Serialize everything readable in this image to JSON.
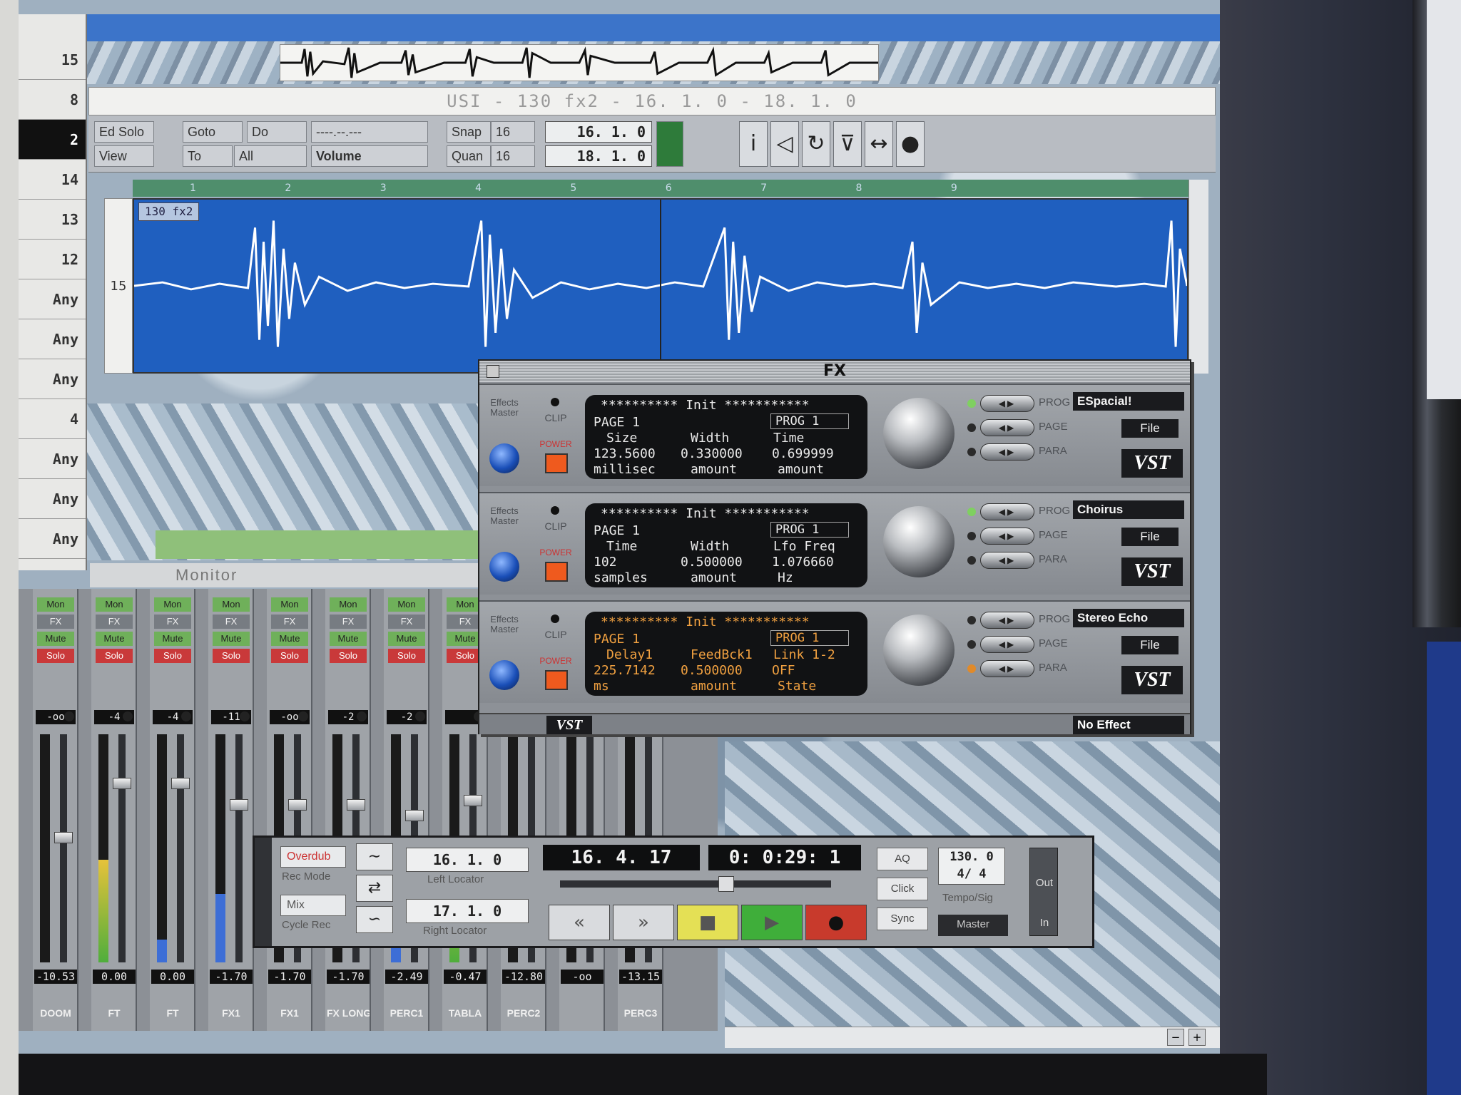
{
  "colors": {
    "accent_blue": "#1f5fbf",
    "mon_green": "#6fb05a",
    "solo_red": "#c9393a",
    "power_orange": "#ef5a1e"
  },
  "tracks": {
    "numbers": [
      "15",
      "8",
      "2",
      "14",
      "13",
      "12",
      "Any",
      "Any",
      "Any",
      "4",
      "Any",
      "Any",
      "Any"
    ]
  },
  "editor": {
    "title": "USI - 130 fx2 -  16. 1.  0 - 18. 1.  0",
    "buttons": {
      "ed_solo": "Ed Solo",
      "view": "View",
      "goto": "Goto",
      "do": "Do",
      "to": "To",
      "all": "All",
      "volume": "Volume",
      "snap": "Snap",
      "snap_val": "16",
      "quan": "Quan",
      "quan_val": "16",
      "blank_field": "----.--.---"
    },
    "loc_start": "16.  1.   0",
    "loc_end": "18.  1.   0",
    "tool_icons": [
      "info-icon",
      "speaker-icon",
      "loop-tool-icon",
      "glue-icon",
      "resize-icon",
      "color-palette-icon"
    ],
    "wave_tag": "130 fx2",
    "wave_track": "15"
  },
  "monitor_label": "Monitor",
  "mixer": {
    "labels": {
      "mon": "Mon",
      "fx": "FX",
      "mute": "Mute",
      "solo": "Solo"
    },
    "strips": [
      {
        "name": "DOOM",
        "val": "-oo",
        "db": "-10.53",
        "level": 0.0,
        "fader": 0.55
      },
      {
        "name": "FT",
        "val": "-4",
        "db": "0.00",
        "level": 0.45,
        "fader": 0.8
      },
      {
        "name": "FT",
        "val": "-4",
        "db": "0.00",
        "level": 0.1,
        "fader": 0.8
      },
      {
        "name": "FX1",
        "val": "-11",
        "db": "-1.70",
        "level": 0.3,
        "fader": 0.7
      },
      {
        "name": "FX1",
        "val": "-oo",
        "db": "-1.70",
        "level": 0.0,
        "fader": 0.7
      },
      {
        "name": "FX LONG",
        "val": "-2",
        "db": "-1.70",
        "level": 0.0,
        "fader": 0.7
      },
      {
        "name": "PERC1",
        "val": "-2",
        "db": "-2.49",
        "level": 0.35,
        "fader": 0.65
      },
      {
        "name": "TABLA",
        "val": "",
        "db": "-0.47",
        "level": 0.55,
        "fader": 0.72
      },
      {
        "name": "PERC2",
        "val": "",
        "db": "-12.80",
        "level": 0.0,
        "fader": 0.0
      },
      {
        "name": "",
        "val": "",
        "db": "-oo",
        "level": 0.0,
        "fader": 0.0
      },
      {
        "name": "PERC3",
        "val": "",
        "db": "-13.15",
        "level": 0.0,
        "fader": 0.0
      }
    ]
  },
  "fx": {
    "title": "FX",
    "side": {
      "effects_master": "Effects Master",
      "clip": "CLIP",
      "power": "POWER"
    },
    "selector_labels": {
      "prog": "PROG",
      "page": "PAGE",
      "para": "PARA"
    },
    "file_label": "File",
    "vst_label": "VST",
    "no_effect": "No Effect",
    "units": [
      {
        "name": "ESpacial!",
        "header": "********** Init ***********",
        "page": "PAGE  1",
        "prog": "PROG  1",
        "params": [
          "Size",
          "Width",
          "Time"
        ],
        "values": [
          "123.5600",
          "0.330000",
          "0.699999"
        ],
        "units": [
          "millisec",
          "amount",
          "amount"
        ]
      },
      {
        "name": "Choirus",
        "header": "********** Init ***********",
        "page": "PAGE  1",
        "prog": "PROG  1",
        "params": [
          "Time",
          "Width",
          "Lfo Freq"
        ],
        "values": [
          "102",
          "0.500000",
          "1.076660"
        ],
        "units": [
          "samples",
          "amount",
          "Hz"
        ]
      },
      {
        "name": "Stereo Echo",
        "header": "********** Init ***********",
        "page": "PAGE  1",
        "prog": "PROG  1",
        "params": [
          "Delay1",
          "FeedBck1",
          "Link 1-2"
        ],
        "values": [
          "225.7142",
          "0.500000",
          "OFF"
        ],
        "units": [
          "ms",
          "amount",
          "State"
        ]
      }
    ]
  },
  "transport": {
    "overdub": "Overdub",
    "rec_mode": "Rec Mode",
    "mix": "Mix",
    "cycle_rec": "Cycle Rec",
    "left_locator": "16.  1.   0",
    "left_locator_label": "Left Locator",
    "right_locator": "17.  1.   0",
    "right_locator_label": "Right Locator",
    "position": "16.  4. 17",
    "time": "0: 0:29:  1",
    "song_position": 0.62,
    "aq": "AQ",
    "click": "Click",
    "sync": "Sync",
    "tempo": "130.  0",
    "signature": "4/  4",
    "tempo_label": "Tempo/Sig",
    "master": "Master",
    "out": "Out",
    "in": "In",
    "icons": [
      "rewind-icon",
      "fast-forward-icon",
      "stop-icon",
      "play-icon",
      "record-icon"
    ]
  }
}
